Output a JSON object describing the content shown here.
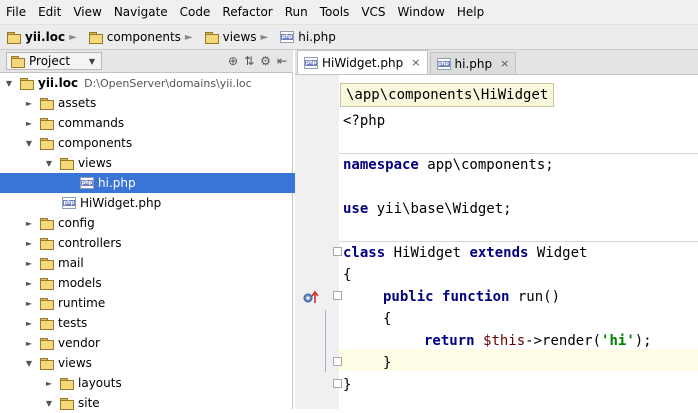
{
  "menu": [
    "File",
    "Edit",
    "View",
    "Navigate",
    "Code",
    "Refactor",
    "Run",
    "Tools",
    "VCS",
    "Window",
    "Help"
  ],
  "breadcrumb": [
    "yii.loc",
    "components",
    "views",
    "hi.php"
  ],
  "project_panel": {
    "selector_label": "Project",
    "tree": [
      {
        "label": "yii.loc",
        "path": "D:\\OpenServer\\domains\\yii.loc",
        "type": "folder",
        "expanded": true,
        "depth": 0
      },
      {
        "label": "assets",
        "type": "folder",
        "expanded": false,
        "depth": 1
      },
      {
        "label": "commands",
        "type": "folder",
        "expanded": false,
        "depth": 1
      },
      {
        "label": "components",
        "type": "folder",
        "expanded": true,
        "depth": 1
      },
      {
        "label": "views",
        "type": "folder",
        "expanded": true,
        "depth": 2
      },
      {
        "label": "hi.php",
        "type": "php",
        "selected": true,
        "depth": 3
      },
      {
        "label": "HiWidget.php",
        "type": "php",
        "depth": 2
      },
      {
        "label": "config",
        "type": "folder",
        "expanded": false,
        "depth": 1
      },
      {
        "label": "controllers",
        "type": "folder",
        "expanded": false,
        "depth": 1
      },
      {
        "label": "mail",
        "type": "folder",
        "expanded": false,
        "depth": 1
      },
      {
        "label": "models",
        "type": "folder",
        "expanded": false,
        "depth": 1
      },
      {
        "label": "runtime",
        "type": "folder",
        "expanded": false,
        "depth": 1
      },
      {
        "label": "tests",
        "type": "folder",
        "expanded": false,
        "depth": 1
      },
      {
        "label": "vendor",
        "type": "folder",
        "expanded": false,
        "depth": 1
      },
      {
        "label": "views",
        "type": "folder",
        "expanded": true,
        "depth": 1
      },
      {
        "label": "layouts",
        "type": "folder",
        "expanded": false,
        "depth": 2
      },
      {
        "label": "site",
        "type": "folder",
        "expanded": true,
        "depth": 2
      }
    ]
  },
  "tabs": [
    {
      "label": "HiWidget.php",
      "active": true,
      "close": "×"
    },
    {
      "label": "hi.php",
      "active": false,
      "close": "×"
    }
  ],
  "editor": {
    "namespace_popup": "\\app\\components\\HiWidget",
    "code": {
      "l1": "<?php",
      "l2_kw": "namespace",
      "l2_rest": " app\\components;",
      "l3_kw": "use",
      "l3_rest": " yii\\base\\Widget;",
      "l4_kw1": "class",
      "l4_mid": " HiWidget ",
      "l4_kw2": "extends",
      "l4_rest": " Widget",
      "l5": "{",
      "l6_kw1": "public",
      "l6_kw2": "function",
      "l6_rest": " run()",
      "l7": "{",
      "l8_kw": "return",
      "l8_var": "$this",
      "l8_mid": "->render(",
      "l8_str": "'hi'",
      "l8_end": ");",
      "l9": "}",
      "l10": "}"
    }
  }
}
